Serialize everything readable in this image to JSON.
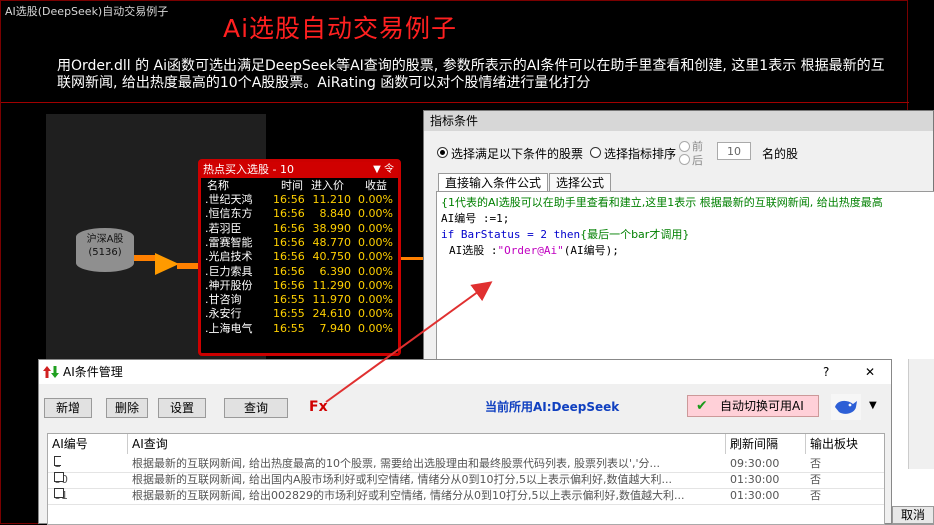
{
  "main": {
    "window_title": "AI选股(DeepSeek)自动交易例子",
    "heading": "Ai选股自动交易例子",
    "description": "用Order.dll 的 Ai函数可选出满足DeepSeek等AI查询的股票, 参数所表示的AI条件可以在助手里查看和创建, 这里1表示 根据最新的互联网新闻, 给出热度最高的10个A股股票。AiRating 函数可以对个股情绪进行量化打分"
  },
  "flow": {
    "db_label": "沪深A股",
    "db_count": "(5136)"
  },
  "hot_panel": {
    "title": "热点买入选股 - 10",
    "ctrl": "▼ 令",
    "columns": [
      "名称",
      "时间",
      "进入价",
      "收益"
    ],
    "rows": [
      {
        "name": ".世纪天鸿",
        "time": "16:56",
        "price": "11.210",
        "gain": "0.00%"
      },
      {
        "name": ".恒信东方",
        "time": "16:56",
        "price": "8.840",
        "gain": "0.00%"
      },
      {
        "name": ".若羽臣",
        "time": "16:56",
        "price": "38.990",
        "gain": "0.00%"
      },
      {
        "name": ".雷赛智能",
        "time": "16:56",
        "price": "48.770",
        "gain": "0.00%"
      },
      {
        "name": ".光启技术",
        "time": "16:56",
        "price": "40.750",
        "gain": "0.00%"
      },
      {
        "name": ".巨力索具",
        "time": "16:56",
        "price": "6.390",
        "gain": "0.00%"
      },
      {
        "name": ".神开股份",
        "time": "16:56",
        "price": "11.290",
        "gain": "0.00%"
      },
      {
        "name": ".甘咨询",
        "time": "16:55",
        "price": "11.970",
        "gain": "0.00%"
      },
      {
        "name": ".永安行",
        "time": "16:55",
        "price": "24.610",
        "gain": "0.00%"
      },
      {
        "name": ".上海电气",
        "time": "16:55",
        "price": "7.940",
        "gain": "0.00%"
      }
    ]
  },
  "indicator_dialog": {
    "title": "指标条件",
    "radio_condition": "选择满足以下条件的股票",
    "radio_sort": "选择指标排序",
    "radio_front": "前",
    "radio_back": "后",
    "n_value": "10",
    "n_suffix": "名的股",
    "tab_input": "直接输入条件公式",
    "tab_select": "选择公式",
    "code_comment": "{1代表的AI选股可以在助手里查看和建立,这里1表示 根据最新的互联网新闻, 给出热度最高",
    "code_line2": "AI编号 :=1;",
    "code_line3_kw": "if BarStatus = 2 then",
    "code_line3_comment": "{最后一个bar才调用}",
    "code_line4_prefix": "AI选股 :",
    "code_line4_str": "\"Order@Ai\"",
    "code_line4_suffix": "(AI编号);"
  },
  "ai_dialog": {
    "title": "AI条件管理",
    "help": "?",
    "close": "✕",
    "btn_new": "新增",
    "btn_delete": "删除",
    "btn_settings": "设置",
    "btn_query": "查询",
    "fx": "Fx",
    "current_ai": "当前所用AI:DeepSeek",
    "auto_switch": "自动切换可用AI",
    "columns": [
      "AI编号",
      "AI查询",
      "刷新间隔",
      "输出板块"
    ],
    "rows": [
      {
        "id": "1",
        "query": "根据最新的互联网新闻, 给出热度最高的10个股票, 需要给出选股理由和最终股票代码列表, 股票列表以','分...",
        "interval": "09:30:00",
        "output": "否"
      },
      {
        "id": "80",
        "query": "根据最新的互联网新闻, 给出国内A股市场利好或利空情绪, 情绪分从0到10打分,5以上表示偏利好,数值越大利...",
        "interval": "01:30:00",
        "output": "否"
      },
      {
        "id": "81",
        "query": "根据最新的互联网新闻, 给出002829的市场利好或利空情绪, 情绪分从0到10打分,5以上表示偏利好,数值越大利...",
        "interval": "01:30:00",
        "output": "否"
      }
    ]
  },
  "cancel": "取消",
  "colors": {
    "heading_red": "#ff2020",
    "panel_red": "#cc0000",
    "price_yellow": "#ffd000",
    "code_green": "#008000",
    "code_blue": "#0000cc",
    "accent_orange": "#ff8000",
    "arrow_red": "#e03030"
  }
}
